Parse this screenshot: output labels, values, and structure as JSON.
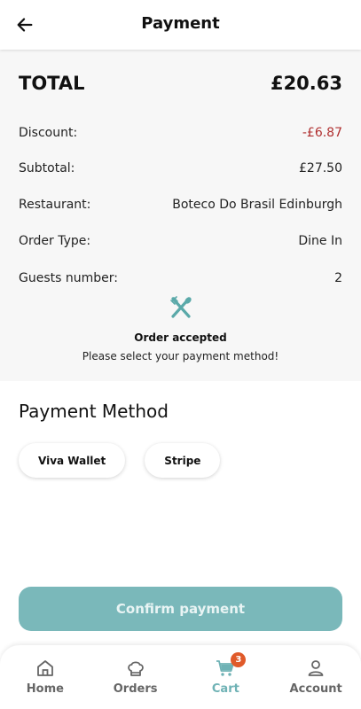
{
  "header": {
    "title": "Payment",
    "back_icon": "arrow-left-icon"
  },
  "summary": {
    "total_label": "TOTAL",
    "total_value": "£20.63",
    "rows": [
      {
        "label": "Discount:",
        "value": "-£6.87"
      },
      {
        "label": "Subtotal:",
        "value": "£27.50"
      },
      {
        "label": "Restaurant:",
        "value": "Boteco Do Brasil Edinburgh"
      },
      {
        "label": "Order Type:",
        "value": "Dine In"
      },
      {
        "label": "Guests number:",
        "value": "2"
      }
    ]
  },
  "status": {
    "icon": "utensils-icon",
    "title": "Order accepted",
    "subtitle": "Please select your payment method!"
  },
  "payment_method": {
    "title": "Payment Method",
    "options": [
      "Viva Wallet",
      "Stripe"
    ]
  },
  "confirm_label": "Confirm payment",
  "nav": {
    "items": [
      {
        "label": "Home",
        "icon": "home-icon"
      },
      {
        "label": "Orders",
        "icon": "chef-hat-icon"
      },
      {
        "label": "Cart",
        "icon": "cart-icon",
        "badge": "3",
        "active": true
      },
      {
        "label": "Account",
        "icon": "user-icon"
      }
    ]
  },
  "colors": {
    "accent": "#7ab8ba",
    "accent_active": "#6fb2b5",
    "discount": "#b03030",
    "badge": "#e05a2a"
  }
}
